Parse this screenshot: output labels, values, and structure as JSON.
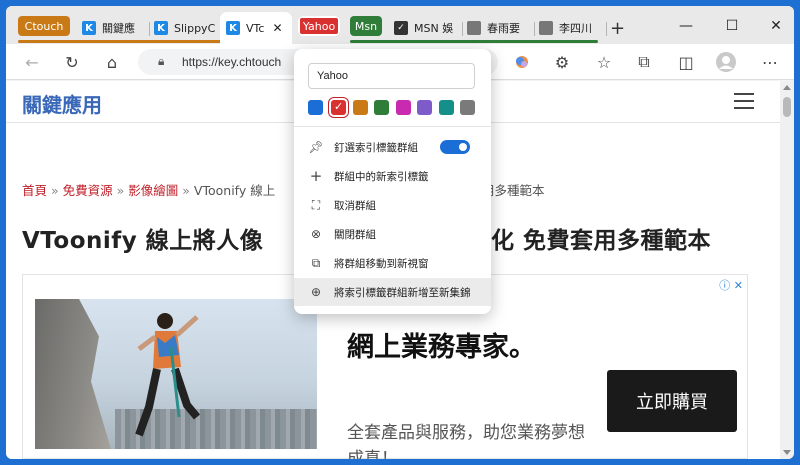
{
  "tabstrip": {
    "groups": [
      {
        "label": "Ctouch",
        "color": "#c97a16"
      },
      {
        "label": "Yahoo",
        "color": "#d93030"
      },
      {
        "label": "Msn",
        "color": "#2f7d39"
      }
    ],
    "tabs": [
      {
        "title": "關鍵應",
        "favicon": "K"
      },
      {
        "title": "SlippyC",
        "favicon": "K"
      },
      {
        "title": "VTc",
        "favicon": "K"
      },
      {
        "title": "MSN 娛",
        "favicon": "msn"
      },
      {
        "title": "春雨要",
        "favicon": "doc"
      },
      {
        "title": "李四川",
        "favicon": "doc"
      }
    ],
    "new_tab": "+",
    "window_controls": {
      "minimize": "—",
      "maximize": "☐",
      "close": "✕"
    }
  },
  "toolbar": {
    "address": "https://key.chtouch",
    "icons": [
      "back-icon",
      "refresh-icon",
      "home-icon",
      "lock-icon",
      "extension-icon",
      "puzzle-icon",
      "favorites-icon",
      "collections-icon",
      "copilot-icon",
      "profile-icon",
      "more-icon"
    ]
  },
  "site": {
    "title": "關鍵應用"
  },
  "breadcrumb": {
    "items": [
      "首頁",
      "免費資源",
      "影像繪圖"
    ],
    "separator": "»",
    "current": "VToonify 線上",
    "current_tail": "用多種範本"
  },
  "headline": {
    "start": "VToonify 線上將人像",
    "end": "化 免費套用多種範本"
  },
  "ad": {
    "adchoice": "ⓘ ✕",
    "title": "網上業務專家。",
    "body": "全套產品與服務，助您業務夢想成真！",
    "cta": "立即購買"
  },
  "menu": {
    "group_name": "Yahoo",
    "colors": [
      "#1a6ed6",
      "#d93030",
      "#c97a16",
      "#2f7d39",
      "#c92bb0",
      "#7d5bc9",
      "#148f8a",
      "#7a7a7a"
    ],
    "selected_color_index": 1,
    "check_mark": "✓",
    "items": [
      {
        "label": "釘選索引標籤群組",
        "icon": "pin-icon",
        "toggle": true
      },
      {
        "label": "群組中的新索引標籤",
        "icon": "plus-icon"
      },
      {
        "label": "取消群組",
        "icon": "ungroup-icon"
      },
      {
        "label": "關閉群組",
        "icon": "close-circle-icon"
      },
      {
        "label": "將群組移動到新視窗",
        "icon": "move-window-icon"
      },
      {
        "label": "將索引標籤群組新增至新集錦",
        "icon": "add-collection-icon"
      }
    ]
  }
}
